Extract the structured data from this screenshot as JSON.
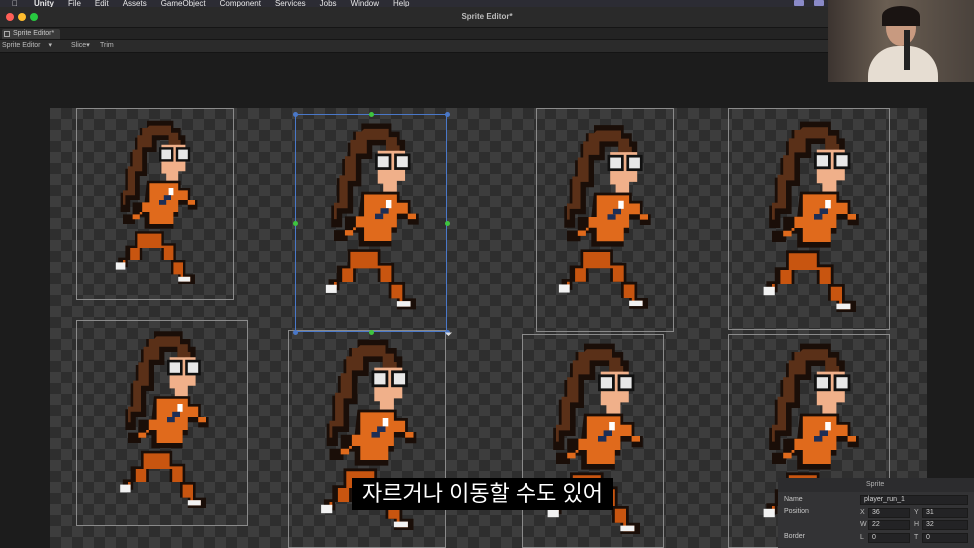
{
  "menubar": {
    "app": "Unity",
    "items": [
      "File",
      "Edit",
      "Assets",
      "GameObject",
      "Component",
      "Services",
      "Jobs",
      "Window",
      "Help"
    ]
  },
  "window": {
    "title": "Sprite Editor*",
    "tab_label": "Sprite Editor*"
  },
  "toolbar": {
    "mode": "Sprite Editor",
    "slice": "Slice",
    "trim": "Trim"
  },
  "subtitle": "자르거나 이동할 수도 있어",
  "sprite_panel": {
    "header": "Sprite",
    "name_label": "Name",
    "name_value": "player_run_1",
    "position_label": "Position",
    "x_label": "X",
    "x_value": "36",
    "y_label": "Y",
    "y_value": "31",
    "w_label": "W",
    "w_value": "22",
    "h_label": "H",
    "h_value": "32",
    "border_label": "Border",
    "l_label": "L",
    "l_value": "0",
    "t_label": "T",
    "t_value": "0"
  },
  "colors": {
    "orange": "#e06a1c",
    "hair": "#5a3018",
    "skin": "#f0b08a",
    "selection": "#4a78c8",
    "handle_blue": "#4a78c8",
    "handle_green": "#3ec43e"
  }
}
